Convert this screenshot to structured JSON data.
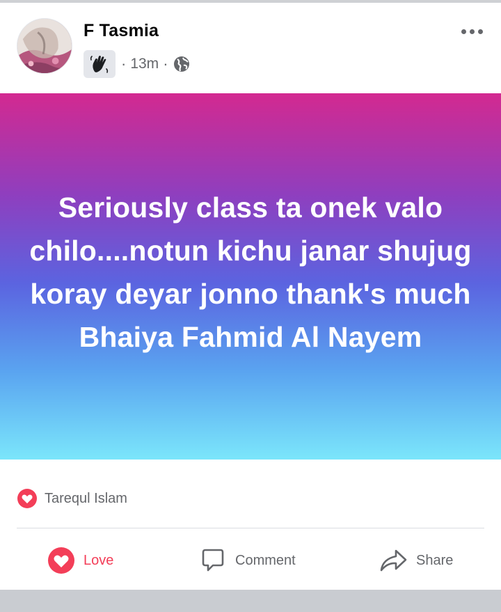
{
  "post": {
    "author_name": "F Tasmia",
    "time": "13m",
    "separator": "·",
    "badge_icon": "waving-hand-badge-icon",
    "privacy_icon": "globe-icon",
    "more_icon": "more-options-icon",
    "text": "Seriously class ta onek valo chilo....notun kichu janar shujug koray deyar jonno thank's much Bhaiya Fahmid Al Nayem",
    "background_gradient": [
      "#d32990",
      "#8e3fbf",
      "#5b64e0",
      "#5aa4f0",
      "#7be6fb"
    ]
  },
  "reactions": {
    "icon": "love-reaction-icon",
    "names": "Tarequl Islam"
  },
  "actions": {
    "love_label": "Love",
    "comment_label": "Comment",
    "share_label": "Share"
  },
  "colors": {
    "love": "#f33e58",
    "secondary_text": "#65676b"
  }
}
